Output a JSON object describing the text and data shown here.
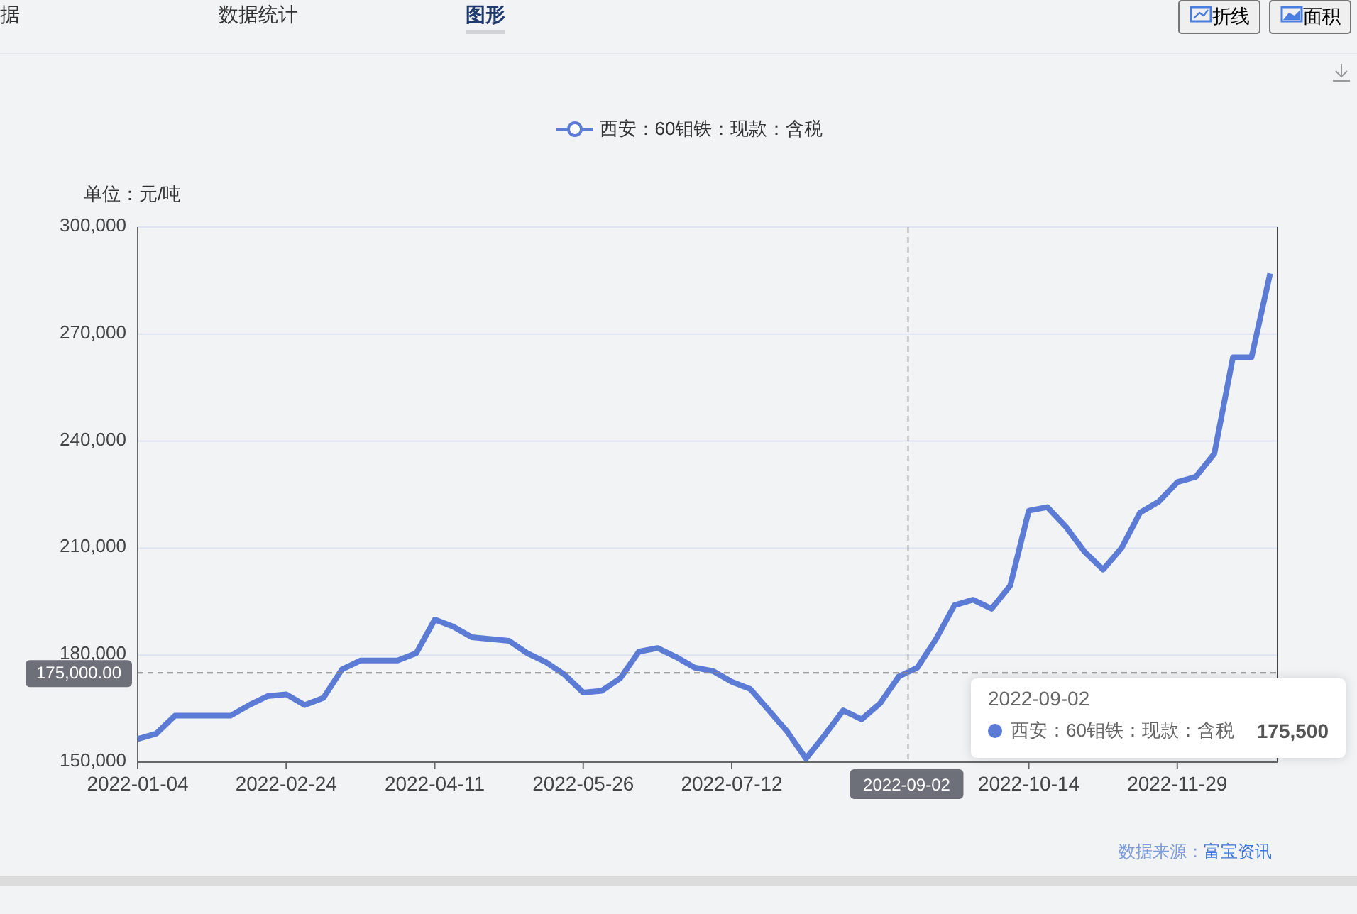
{
  "tabs": [
    {
      "label": "据",
      "selected": false
    },
    {
      "label": "数据统计",
      "selected": false
    },
    {
      "label": "图形",
      "selected": true
    }
  ],
  "view_buttons": [
    {
      "label": "折线",
      "kind": "line"
    },
    {
      "label": "面积",
      "kind": "area"
    }
  ],
  "chart": {
    "unit_label": "单位：元/吨",
    "chart_data": {
      "type": "line",
      "categories": [
        "2022-01-04",
        null,
        null,
        null,
        null,
        null,
        null,
        null,
        "2022-02-24",
        null,
        null,
        null,
        null,
        null,
        null,
        null,
        "2022-04-11",
        null,
        null,
        null,
        null,
        null,
        null,
        null,
        "2022-05-26",
        null,
        null,
        null,
        null,
        null,
        null,
        null,
        "2022-07-12",
        null,
        null,
        null,
        null,
        null,
        null,
        null,
        null,
        null,
        null,
        null,
        null,
        null,
        null,
        null,
        "2022-10-14",
        null,
        null,
        null,
        null,
        null,
        null,
        null,
        "2022-11-29",
        null,
        null,
        null,
        null,
        null
      ],
      "series": [
        {
          "name": "西安：60钼铁：现款：含税",
          "color": "#5b7bd5",
          "values": [
            156500,
            158000,
            163000,
            163000,
            163000,
            163000,
            166000,
            168500,
            169000,
            166000,
            168000,
            176000,
            178500,
            178500,
            178500,
            180500,
            190000,
            188000,
            185000,
            184500,
            184000,
            180500,
            178000,
            174500,
            169500,
            170000,
            173500,
            181000,
            182000,
            179500,
            176500,
            175500,
            172500,
            170500,
            164500,
            158500,
            151000,
            157500,
            164500,
            162000,
            166500,
            174000,
            176500,
            184500,
            194000,
            195500,
            193000,
            199500,
            220500,
            221500,
            216000,
            209000,
            204000,
            210000,
            220000,
            223000,
            228500,
            230000,
            236500,
            263500,
            263500,
            287000
          ]
        }
      ],
      "ylim": [
        150000,
        300000
      ],
      "yticks": [
        {
          "value": 150000,
          "label": "150,000"
        },
        {
          "value": 180000,
          "label": "180,000"
        },
        {
          "value": 210000,
          "label": "210,000"
        },
        {
          "value": 240000,
          "label": "240,000"
        },
        {
          "value": 270000,
          "label": "270,000"
        },
        {
          "value": 300000,
          "label": "300,000"
        }
      ],
      "grid": true,
      "ref_lines": [
        {
          "axis": "y",
          "value": 175000,
          "label": "175,000.00"
        }
      ]
    },
    "axis_pointer": {
      "x_label": "2022-09-02"
    },
    "tooltip": {
      "date": "2022-09-02",
      "series": "西安：60钼铁：现款：含税",
      "value": "175,500"
    }
  },
  "source": {
    "label": "数据来源：",
    "link": "富宝资讯"
  }
}
